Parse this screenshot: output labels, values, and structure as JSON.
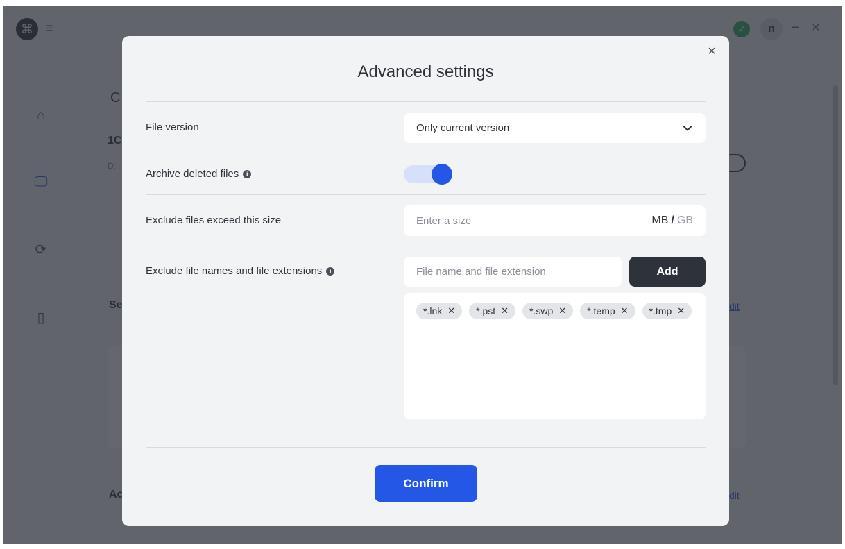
{
  "app": {
    "logo_icon": "logo-icon",
    "menu_icon": "menu-icon",
    "status_icon": "check-icon",
    "status_color": "#2fae60",
    "avatar_initial": "n",
    "minimize_glyph": "−",
    "close_glyph": "×",
    "sidebar": [
      {
        "icon": "home-icon",
        "glyph": "⌂"
      },
      {
        "icon": "monitor-icon",
        "glyph": "🖵"
      },
      {
        "icon": "sync-icon",
        "glyph": "⟳"
      },
      {
        "icon": "phone-icon",
        "glyph": "▯"
      }
    ],
    "partial_texts": {
      "heading_fragment": "C",
      "number_fragment": "1C",
      "small_fragment": "D:",
      "section_fragment_1": "Se",
      "section_fragment_2": "Ac",
      "edit_fragment_1": "dit",
      "edit_fragment_2": "dit"
    }
  },
  "modal": {
    "title": "Advanced settings",
    "close_icon": "close-icon",
    "file_version": {
      "label": "File version",
      "selected": "Only current version"
    },
    "archive_deleted": {
      "label": "Archive deleted files",
      "enabled": true
    },
    "exclude_size": {
      "label": "Exclude files exceed this size",
      "placeholder": "Enter a size",
      "unit_mb": "MB",
      "unit_slash": "/",
      "unit_gb": "GB",
      "selected_unit": "MB"
    },
    "exclude_names": {
      "label": "Exclude file names and file extensions",
      "placeholder": "File name and file extension",
      "add_label": "Add",
      "tags": [
        "*.lnk",
        "*.pst",
        "*.swp",
        "*.temp",
        "*.tmp"
      ]
    },
    "confirm_label": "Confirm"
  },
  "colors": {
    "accent": "#2457e6",
    "dark": "#2e333b",
    "toggle_track": "#d7e0fb"
  }
}
